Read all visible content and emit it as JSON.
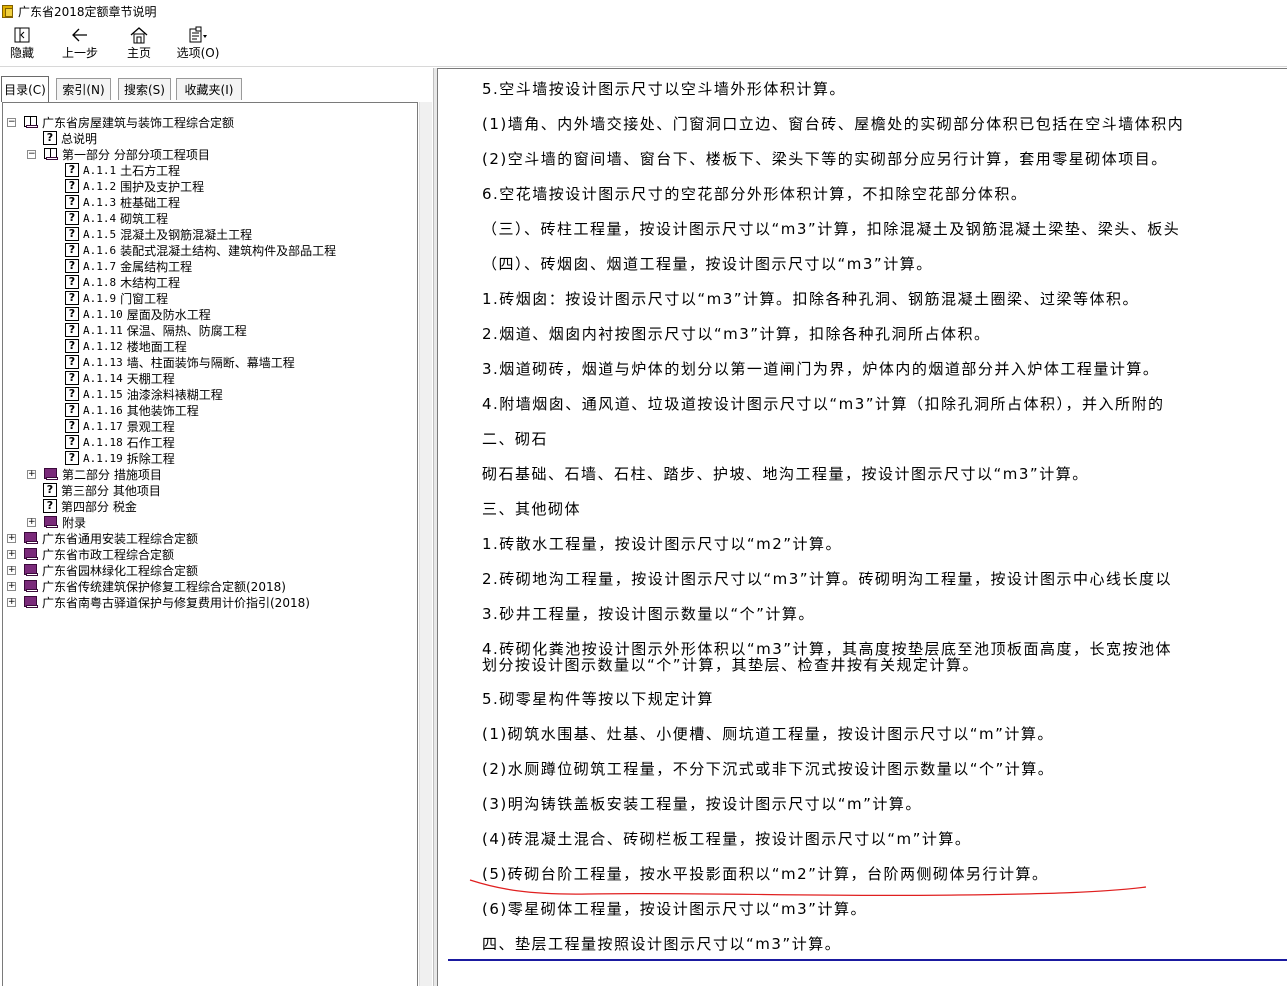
{
  "window": {
    "title": "广东省2018定额章节说明"
  },
  "toolbar": {
    "buttons": [
      {
        "id": "hide",
        "label": "隐藏",
        "icon": "hide-icon"
      },
      {
        "id": "back",
        "label": "上一步",
        "icon": "back-arrow-icon"
      },
      {
        "id": "home",
        "label": "主页",
        "icon": "home-icon"
      },
      {
        "id": "options",
        "label": "选项(O)",
        "icon": "options-icon"
      }
    ]
  },
  "tabs": [
    {
      "label": "目录(C)",
      "active": true
    },
    {
      "label": "索引(N)",
      "active": false
    },
    {
      "label": "搜索(S)",
      "active": false
    },
    {
      "label": "收藏夹(I)",
      "active": false
    }
  ],
  "tree": [
    {
      "label": "广东省房屋建筑与装饰工程综合定额",
      "level": 0,
      "type": "book-open",
      "expander": "minus"
    },
    {
      "label": "总说明",
      "level": 1,
      "type": "page"
    },
    {
      "label": "第一部分 分部分项工程项目",
      "level": 1,
      "type": "book-open",
      "expander": "minus"
    },
    {
      "code": "A.1.1",
      "label": "土石方工程",
      "level": 2,
      "type": "page"
    },
    {
      "code": "A.1.2",
      "label": "围护及支护工程",
      "level": 2,
      "type": "page"
    },
    {
      "code": "A.1.3",
      "label": "桩基础工程",
      "level": 2,
      "type": "page"
    },
    {
      "code": "A.1.4",
      "label": "砌筑工程",
      "level": 2,
      "type": "page"
    },
    {
      "code": "A.1.5",
      "label": "混凝土及钢筋混凝土工程",
      "level": 2,
      "type": "page"
    },
    {
      "code": "A.1.6",
      "label": "装配式混凝土结构、建筑构件及部品工程",
      "level": 2,
      "type": "page"
    },
    {
      "code": "A.1.7",
      "label": "金属结构工程",
      "level": 2,
      "type": "page"
    },
    {
      "code": "A.1.8",
      "label": "木结构工程",
      "level": 2,
      "type": "page"
    },
    {
      "code": "A.1.9",
      "label": "门窗工程",
      "level": 2,
      "type": "page"
    },
    {
      "code": "A.1.10",
      "label": "屋面及防水工程",
      "level": 2,
      "type": "page"
    },
    {
      "code": "A.1.11",
      "label": "保温、隔热、防腐工程",
      "level": 2,
      "type": "page"
    },
    {
      "code": "A.1.12",
      "label": "楼地面工程",
      "level": 2,
      "type": "page"
    },
    {
      "code": "A.1.13",
      "label": "墙、柱面装饰与隔断、幕墙工程",
      "level": 2,
      "type": "page"
    },
    {
      "code": "A.1.14",
      "label": "天棚工程",
      "level": 2,
      "type": "page"
    },
    {
      "code": "A.1.15",
      "label": "油漆涂料裱糊工程",
      "level": 2,
      "type": "page"
    },
    {
      "code": "A.1.16",
      "label": "其他装饰工程",
      "level": 2,
      "type": "page"
    },
    {
      "code": "A.1.17",
      "label": "景观工程",
      "level": 2,
      "type": "page"
    },
    {
      "code": "A.1.18",
      "label": "石作工程",
      "level": 2,
      "type": "page"
    },
    {
      "code": "A.1.19",
      "label": "拆除工程",
      "level": 2,
      "type": "page"
    },
    {
      "label": "第二部分 措施项目",
      "level": 1,
      "type": "book",
      "expander": "plus"
    },
    {
      "label": "第三部分 其他项目",
      "level": 1,
      "type": "page"
    },
    {
      "label": "第四部分 税金",
      "level": 1,
      "type": "page"
    },
    {
      "label": "附录",
      "level": 1,
      "type": "book",
      "expander": "plus"
    },
    {
      "label": "广东省通用安装工程综合定额",
      "level": 0,
      "type": "book",
      "expander": "plus"
    },
    {
      "label": "广东省市政工程综合定额",
      "level": 0,
      "type": "book",
      "expander": "plus"
    },
    {
      "label": "广东省园林绿化工程综合定额",
      "level": 0,
      "type": "book",
      "expander": "plus"
    },
    {
      "label": "广东省传统建筑保护修复工程综合定额(2018)",
      "level": 0,
      "type": "book",
      "expander": "plus"
    },
    {
      "label": "广东省南粤古驿道保护与修复费用计价指引(2018)",
      "level": 0,
      "type": "book",
      "expander": "plus"
    }
  ],
  "content": {
    "paragraphs": [
      "5.空斗墙按设计图示尺寸以空斗墙外形体积计算。",
      "(1)墙角、内外墙交接处、门窗洞口立边、窗台砖、屋檐处的实砌部分体积已包括在空斗墙体积内",
      "(2)空斗墙的窗间墙、窗台下、楼板下、梁头下等的实砌部分应另行计算，套用零星砌体项目。",
      "6.空花墙按设计图示尺寸的空花部分外形体积计算，不扣除空花部分体积。",
      "（三）、砖柱工程量，按设计图示尺寸以“m3”计算，扣除混凝土及钢筋混凝土梁垫、梁头、板头",
      "（四）、砖烟囱、烟道工程量，按设计图示尺寸以“m3”计算。",
      "1.砖烟囱：按设计图示尺寸以“m3”计算。扣除各种孔洞、钢筋混凝土圈梁、过梁等体积。",
      "2.烟道、烟囱内衬按图示尺寸以“m3”计算，扣除各种孔洞所占体积。",
      "3.烟道砌砖，烟道与炉体的划分以第一道闸门为界，炉体内的烟道部分并入炉体工程量计算。",
      "4.附墙烟囱、通风道、垃圾道按设计图示尺寸以“m3”计算（扣除孔洞所占体积），并入所附的",
      "二、砌石",
      "砌石基础、石墙、石柱、踏步、护坡、地沟工程量，按设计图示尺寸以“m3”计算。",
      "三、其他砌体",
      "1.砖散水工程量，按设计图示尺寸以“m2”计算。",
      "2.砖砌地沟工程量，按设计图示尺寸以“m3”计算。砖砌明沟工程量，按设计图示中心线长度以",
      "3.砂井工程量，按设计图示数量以“个”计算。",
      "4.砖砌化粪池按设计图示外形体积以“m3”计算，其高度按垫层底至池顶板面高度，长宽按池体",
      "划分按设计图示数量以“个”计算，其垫层、检查井按有关规定计算。",
      "5.砌零星构件等按以下规定计算",
      "(1)砌筑水围基、灶基、小便槽、厕坑道工程量，按设计图示尺寸以“m”计算。",
      "(2)水厕蹲位砌筑工程量，不分下沉式或非下沉式按设计图示数量以“个”计算。",
      "(3)明沟铸铁盖板安装工程量，按设计图示尺寸以“m”计算。",
      "(4)砖混凝土混合、砖砌栏板工程量，按设计图示尺寸以“m”计算。",
      "(5)砖砌台阶工程量，按水平投影面积以“m2”计算，台阶两侧砌体另行计算。",
      "(6)零星砌体工程量，按设计图示尺寸以“m3”计算。",
      "四、垫层工程量按照设计图示尺寸以“m3”计算。"
    ],
    "annotation_color": "#e02020",
    "rule_color": "#1a1aa0"
  }
}
